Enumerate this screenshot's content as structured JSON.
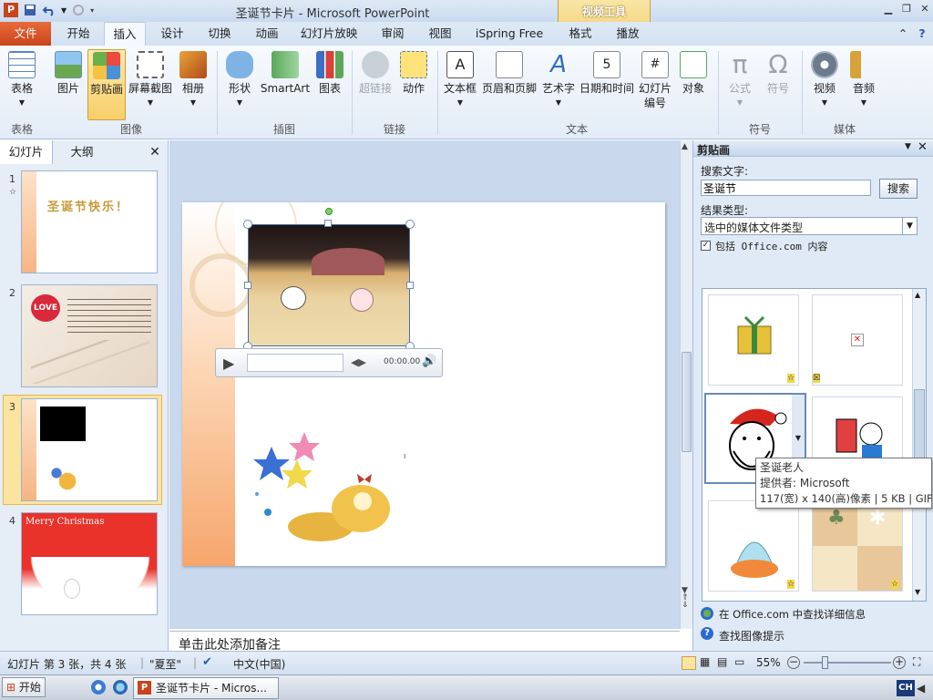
{
  "window": {
    "title": "圣诞节卡片 - Microsoft PowerPoint",
    "context_tab_group": "视频工具"
  },
  "tabs": [
    "文件",
    "开始",
    "插入",
    "设计",
    "切换",
    "动画",
    "幻灯片放映",
    "审阅",
    "视图",
    "iSpring Free",
    "格式",
    "播放"
  ],
  "ribbon": {
    "buttons": [
      "表格",
      "图片",
      "剪贴画",
      "屏幕截图",
      "相册",
      "形状",
      "SmartArt",
      "图表",
      "超链接",
      "动作",
      "文本框",
      "页眉和页脚",
      "艺术字",
      "日期和时间",
      "幻灯片\n编号",
      "对象",
      "公式",
      "符号",
      "视频",
      "音频"
    ],
    "groups": [
      "表格",
      "图像",
      "插图",
      "链接",
      "文本",
      "符号",
      "媒体"
    ]
  },
  "slide_panel": {
    "tabs": [
      "幻灯片",
      "大纲"
    ],
    "numbers": [
      "1",
      "2",
      "3",
      "4"
    ],
    "thumb1_text": "圣诞节快乐！",
    "thumb2_badge": "LOVE",
    "thumb4_text": "Merry Christmas"
  },
  "video": {
    "time": "00:00.00"
  },
  "notes": {
    "placeholder": "单击此处添加备注"
  },
  "clip_art": {
    "title": "剪贴画",
    "search_label": "搜索文字:",
    "search_value": "圣诞节",
    "search_button": "搜索",
    "results_label": "结果类型:",
    "results_value": "选中的媒体文件类型",
    "include_label": "包括 Office.com 内容",
    "tooltip": {
      "name": "圣诞老人",
      "provider": "提供者: Microsoft",
      "info": "117(宽) x 140(高)像素 | 5 KB | GIF"
    },
    "link1": "在 Office.com 中查找详细信息",
    "link2": "查找图像提示"
  },
  "status": {
    "slide_info": "幻灯片 第 3 张，共 4 张",
    "theme": "\"夏至\"",
    "language": "中文(中国)",
    "zoom": "55%"
  },
  "taskbar": {
    "start": "开始",
    "item": "圣诞节卡片 - Micros...",
    "ime": "CH"
  },
  "colors": {
    "file_tab": "#d55a2b",
    "accent": "#f0cd6c",
    "ribbon_bg": "#e3ecf7"
  }
}
